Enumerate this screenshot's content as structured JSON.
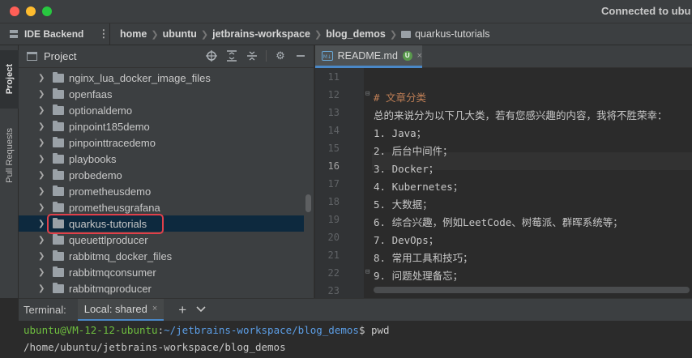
{
  "window": {
    "title": "Connected to ubu"
  },
  "navbar": {
    "backend_label": "IDE Backend",
    "kebab": "⋮",
    "breadcrumbs": [
      "home",
      "ubuntu",
      "jetbrains-workspace",
      "blog_demos",
      "quarkus-tutorials"
    ]
  },
  "toolstrip": {
    "project": "Project",
    "pull_requests": "Pull Requests"
  },
  "project_panel": {
    "title": "Project",
    "folders": [
      "nginx_lua_docker_image_files",
      "openfaas",
      "optionaldemo",
      "pinpoint185demo",
      "pinpointtracedemo",
      "playbooks",
      "probedemo",
      "prometheusdemo",
      "prometheusgrafana",
      "quarkus-tutorials",
      "queuettlproducer",
      "rabbitmq_docker_files",
      "rabbitmqconsumer",
      "rabbitmqproducer"
    ],
    "selected_index": 9
  },
  "editor": {
    "tab": {
      "label": "README.md",
      "badge": "U",
      "close": "×",
      "icon": "M↓"
    },
    "first_line": 11,
    "current_line": 16,
    "lines": [
      "",
      "# 文章分类",
      "总的来说分为以下几大类，若有您感兴趣的内容，我将不胜荣幸：",
      "1. Java；",
      "2. 后台中间件；",
      "3. Docker；",
      "4. Kubernetes；",
      "5. 大数据；",
      "6. 综合兴趣，例如LeetCode、树莓派、群晖系统等；",
      "7. DevOps；",
      "8. 常用工具和技巧；",
      "9. 问题处理备忘；",
      ""
    ],
    "line_numbers": [
      "11",
      "12",
      "13",
      "14",
      "15",
      "16",
      "17",
      "18",
      "19",
      "20",
      "21",
      "22",
      "23"
    ]
  },
  "terminal": {
    "label": "Terminal:",
    "tab_label": "Local: shared",
    "tab_close": "×",
    "add": "+",
    "more": "⌄",
    "prompt_user": "ubuntu@VM-12-12-ubuntu",
    "prompt_colon": ":",
    "prompt_path": "~/jetbrains-workspace/blog_demos",
    "prompt_cmd": "$ pwd",
    "output": "/home/ubuntu/jetbrains-workspace/blog_demos"
  },
  "colors": {
    "accent": "#4a88c7",
    "highlight_box": "#e0404a",
    "selected_row": "#0d293e"
  }
}
